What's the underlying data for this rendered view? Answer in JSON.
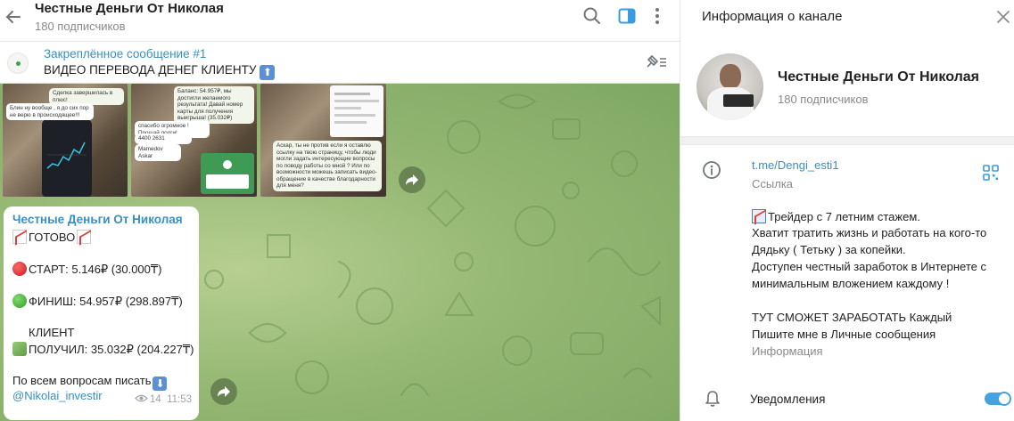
{
  "header": {
    "channel_title": "Честные Деньги От Николая",
    "subscribers": "180 подписчиков"
  },
  "pinned": {
    "title": "Закреплённое сообщение #1",
    "text": "ВИДЕО ПЕРЕВОДА ДЕНЕГ КЛИЕНТУ",
    "arrow": "⬆"
  },
  "photos": {
    "p1": {
      "bubble1": "Сделка завершилась в плюс!",
      "bubble2": "Блин ну вообще , я до сих пор не верю в происходящее!!!"
    },
    "p2": {
      "bubble1": "Баланс: 54.957₽, мы достигли желаемого результата! Давай номер карты для получения выигрыша! (35.032₽)",
      "bubble2": "спасибо огромное ! Прощай долги!",
      "bubble3": "4400 2631",
      "bubble4": "Mamedov Askar"
    },
    "p3": {
      "bubble1": "Аскар, ты не против если я оставлю ссылку на твою страницу, чтобы люди могли задать интересующие вопросы по поводу работы со мной ? Или по возможности можешь записать видео-обращение в качестве благодарности для меня?"
    }
  },
  "message": {
    "author": "Честные Деньги От Николая",
    "line1": "ГОТОВО",
    "line2": "СТАРТ:  5.146₽ (30.000₸)",
    "line3": "ФИНИШ:  54.957₽ (298.897₸)",
    "line4": "КЛИЕНТ",
    "line5": "ПОЛУЧИЛ: 35.032₽ (204.227₸)",
    "line6": "По всем вопросам писать",
    "link": "@Nikolai_investir",
    "views": "14",
    "time": "11:53"
  },
  "info": {
    "panel_title": "Информация о канале",
    "name": "Честные Деньги От Николая",
    "subscribers": "180 подписчиков",
    "link": "t.me/Dengi_esti1",
    "link_caption": "Ссылка",
    "bio": [
      "Трейдер с 7 летним стажем.",
      " Хватит тратить жизнь и работать на кого-то",
      "Дядьку ( Тетьку ) за копейки.",
      " Доступен честный заработок в Интернете с",
      "минимальным вложением каждому !",
      "",
      "ТУТ СМОЖЕТ ЗАРАБОТАТЬ Каждый",
      "Пишите мне в Личные сообщения"
    ],
    "bio_caption": "Информация",
    "notifications_label": "Уведомления",
    "notifications_on": true
  },
  "colors": {
    "accent": "#3a8fc2",
    "toggle": "#45a3df",
    "chat_bg": "#95b874"
  }
}
